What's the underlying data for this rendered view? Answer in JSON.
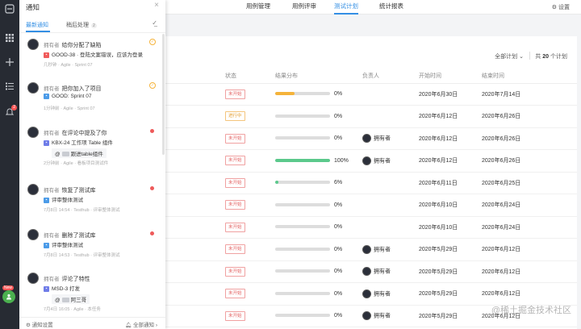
{
  "rail": {
    "badge": "2",
    "new_label": "New"
  },
  "topnav": {
    "tabs": [
      "用例管理",
      "用例评审",
      "测试计划",
      "统计报表"
    ],
    "settings": "设置"
  },
  "toolbar": {
    "filter": "全部计划",
    "count_prefix": "共",
    "count_value": "20",
    "count_suffix": "个计划"
  },
  "table": {
    "headers": [
      "状态",
      "结果分布",
      "负责人",
      "开始时间",
      "结束时间"
    ],
    "rows": [
      {
        "status": "未开始",
        "status_type": "todo",
        "progress": 0,
        "bar_fraction": 0.35,
        "bar_color": "#f5b33a",
        "pct": "0%",
        "owner": "",
        "start": "2020年6月30日",
        "end": "2020年7月14日"
      },
      {
        "status": "进行中",
        "status_type": "doing",
        "progress": 0,
        "bar_fraction": 0,
        "bar_color": "#ccc",
        "pct": "0%",
        "owner": "",
        "start": "2020年6月12日",
        "end": "2020年6月26日"
      },
      {
        "status": "未开始",
        "status_type": "todo",
        "progress": 0,
        "bar_fraction": 0,
        "bar_color": "#ccc",
        "pct": "0%",
        "owner": "拥有者",
        "start": "2020年6月12日",
        "end": "2020年6月26日"
      },
      {
        "status": "未开始",
        "status_type": "todo",
        "progress": 100,
        "bar_fraction": 1,
        "bar_color": "#5bc98c",
        "pct": "100%",
        "owner": "拥有者",
        "start": "2020年6月12日",
        "end": "2020年6月26日"
      },
      {
        "status": "未开始",
        "status_type": "todo",
        "progress": 6,
        "bar_fraction": 0.06,
        "bar_color": "#5bc98c",
        "pct": "6%",
        "owner": "",
        "start": "2020年6月11日",
        "end": "2020年6月25日"
      },
      {
        "status": "未开始",
        "status_type": "todo",
        "progress": 0,
        "bar_fraction": 0,
        "bar_color": "#ccc",
        "pct": "0%",
        "owner": "",
        "start": "2020年6月10日",
        "end": "2020年6月24日"
      },
      {
        "status": "未开始",
        "status_type": "todo",
        "progress": 0,
        "bar_fraction": 0,
        "bar_color": "#ccc",
        "pct": "0%",
        "owner": "",
        "start": "2020年6月10日",
        "end": "2020年6月24日"
      },
      {
        "status": "未开始",
        "status_type": "todo",
        "progress": 0,
        "bar_fraction": 0,
        "bar_color": "#ccc",
        "pct": "0%",
        "owner": "拥有者",
        "start": "2020年5月29日",
        "end": "2020年6月12日"
      },
      {
        "status": "未开始",
        "status_type": "todo",
        "progress": 0,
        "bar_fraction": 0,
        "bar_color": "#ccc",
        "pct": "0%",
        "owner": "拥有者",
        "start": "2020年5月29日",
        "end": "2020年6月12日"
      },
      {
        "status": "未开始",
        "status_type": "todo",
        "progress": 0,
        "bar_fraction": 0,
        "bar_color": "#ccc",
        "pct": "0%",
        "owner": "拥有者",
        "start": "2020年5月29日",
        "end": "2020年6月12日"
      },
      {
        "status": "未开始",
        "status_type": "todo",
        "progress": 0,
        "bar_fraction": 0,
        "bar_color": "#ccc",
        "pct": "0%",
        "owner": "拥有者",
        "start": "2020年5月29日",
        "end": "2020年6月12日"
      }
    ]
  },
  "panel": {
    "title": "通知",
    "tabs": [
      {
        "label": "最新通知"
      },
      {
        "label": "稍后处理",
        "count": "2"
      }
    ],
    "notifications": [
      {
        "actor": "拥有者",
        "action": "给你分配了缺陷",
        "icon_color": "#f05b5b",
        "item": "GOOD-38 · 登陆文案错误，应该为登录",
        "meta": "几秒钟 · Agile · Sprint 07",
        "marker": "check"
      },
      {
        "actor": "拥有者",
        "action": "把你加入了项目",
        "icon_color": "#4b9be8",
        "item": "GOOD: Sprint 07",
        "meta": "1分钟前 · Agile · Sprint 07",
        "marker": "check"
      },
      {
        "actor": "拥有者",
        "action": "在评论中提及了你",
        "icon_color": "#6f7ce8",
        "item": "KBX-24 工作项 Table 组件",
        "sub": "跟进table组件",
        "meta": "2分钟前 · Agile · 看板项目测试件",
        "marker": "dot"
      },
      {
        "actor": "拥有者",
        "action": "恢复了测试库",
        "icon_color": "#4b9be8",
        "item": "评审整体测试",
        "meta": "7月8日 14:54 · Testhub · 评审整体测试",
        "marker": "dot"
      },
      {
        "actor": "拥有者",
        "action": "删除了测试库",
        "icon_color": "#4b9be8",
        "item": "评审整体测试",
        "meta": "7月8日 14:53 · Testhub · 评审整体测试",
        "marker": "dot"
      },
      {
        "actor": "拥有者",
        "action": "评论了特性",
        "icon_color": "#6f7ce8",
        "item": "MSD-3 打发",
        "sub": "阿三哥",
        "meta": "7月4日 16:05 · Agile · 本任务",
        "marker": ""
      }
    ],
    "footer_left": "通知设置",
    "footer_right": "全部通知"
  },
  "watermark": "@稀土掘金技术社区"
}
